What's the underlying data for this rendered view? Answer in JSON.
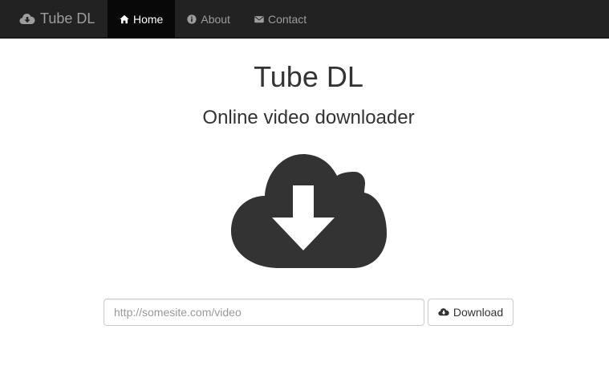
{
  "navbar": {
    "brand_icon": "cloud-download-icon",
    "brand_label": "Tube DL",
    "items": [
      {
        "label": "Home",
        "icon": "home-icon",
        "active": true
      },
      {
        "label": "About",
        "icon": "info-circle-icon",
        "active": false
      },
      {
        "label": "Contact",
        "icon": "envelope-icon",
        "active": false
      }
    ]
  },
  "main": {
    "title": "Tube DL",
    "subtitle": "Online video downloader",
    "hero_icon": "cloud-download-icon"
  },
  "form": {
    "url_placeholder": "http://somesite.com/video",
    "url_value": "",
    "download_label": "Download",
    "download_icon": "cloud-download-icon"
  },
  "colors": {
    "navbar_bg": "#222222",
    "nav_active_bg": "#080808",
    "nav_text": "#9d9d9d",
    "text": "#333333",
    "icon": "#333333"
  }
}
